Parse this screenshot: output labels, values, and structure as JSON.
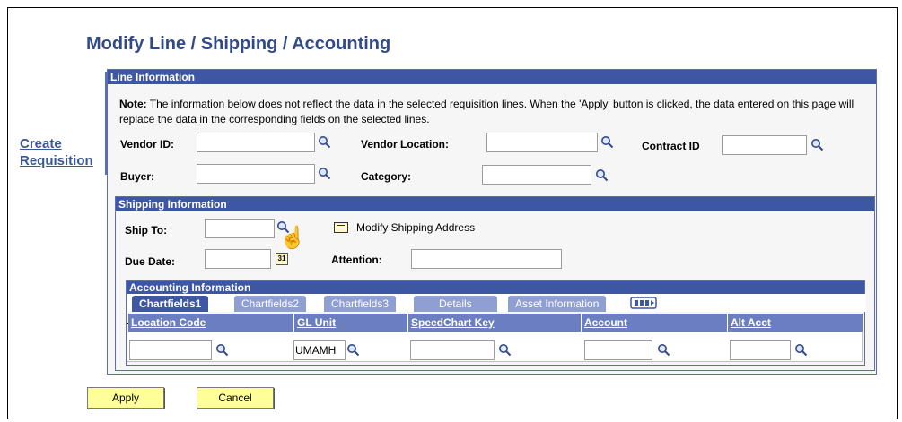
{
  "page": {
    "title": "Modify Line / Shipping / Accounting",
    "side_link_line1": "Create",
    "side_link_line2": "Requisition"
  },
  "line_info": {
    "heading": "Line Information",
    "note_label": "Note:",
    "note_text": " The information below does not reflect the data in the selected requisition lines. When the 'Apply' button is clicked, the data entered on this page will replace the data in the corresponding fields on the selected lines.",
    "vendor_id_label": "Vendor ID:",
    "vendor_id_value": "",
    "vendor_location_label": "Vendor Location:",
    "vendor_location_value": "",
    "contract_id_label": "Contract ID",
    "contract_id_value": "",
    "buyer_label": "Buyer:",
    "buyer_value": "",
    "category_label": "Category:",
    "category_value": ""
  },
  "shipping": {
    "heading": "Shipping Information",
    "ship_to_label": "Ship To:",
    "ship_to_value": "",
    "modify_address_label": "Modify Shipping Address",
    "due_date_label": "Due Date:",
    "due_date_value": "",
    "attention_label": "Attention:",
    "attention_value": ""
  },
  "accounting": {
    "heading": "Accounting Information",
    "tabs": [
      "Chartfields1",
      "Chartfields2",
      "Chartfields3",
      "Details",
      "Asset Information"
    ],
    "columns": [
      "Location Code",
      "GL Unit",
      "SpeedChart Key",
      "Account",
      "Alt Acct"
    ],
    "row": {
      "location_code": "",
      "gl_unit": "UMAMH",
      "speedchart_key": "",
      "account": "",
      "alt_acct": ""
    }
  },
  "buttons": {
    "apply": "Apply",
    "cancel": "Cancel"
  },
  "icons": {
    "lookup": "magnifier-icon",
    "calendar": "calendar-icon",
    "address": "envelope-icon",
    "cursor": "hand-pointer-icon",
    "show_all_tabs": "show-all-tabs-icon"
  }
}
